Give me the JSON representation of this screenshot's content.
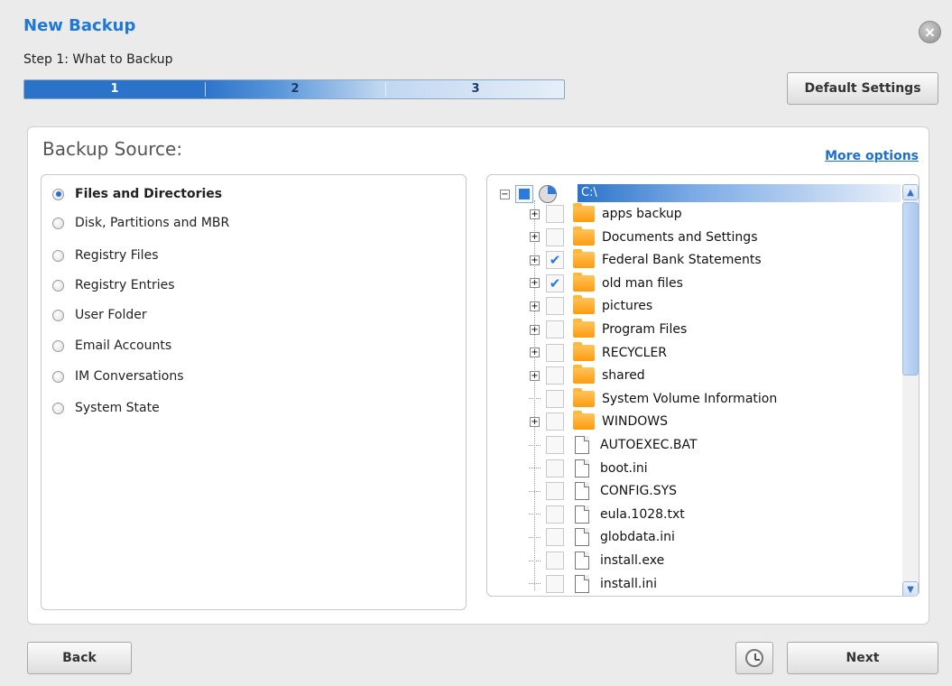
{
  "window": {
    "title": "New Backup",
    "close_glyph": "×"
  },
  "step": {
    "label": "Step 1: What to Backup",
    "numbers": [
      "1",
      "2",
      "3"
    ]
  },
  "buttons": {
    "default_settings": "Default Settings",
    "back": "Back",
    "next": "Next"
  },
  "panel": {
    "title": "Backup Source:",
    "more_options": "More options"
  },
  "source_options": [
    "Files and Directories",
    "Disk, Partitions and MBR",
    "Registry Files",
    "Registry Entries",
    "User Folder",
    "Email Accounts",
    "IM Conversations",
    "System State"
  ],
  "selected_source": "Files and Directories",
  "tree": {
    "root": "C:\\",
    "items": [
      {
        "name": "apps backup",
        "type": "folder",
        "expandable": true,
        "checked": false
      },
      {
        "name": "Documents and Settings",
        "type": "folder",
        "expandable": true,
        "checked": false
      },
      {
        "name": "Federal Bank Statements",
        "type": "folder",
        "expandable": true,
        "checked": true
      },
      {
        "name": "old man files",
        "type": "folder",
        "expandable": true,
        "checked": true
      },
      {
        "name": "pictures",
        "type": "folder",
        "expandable": true,
        "checked": false
      },
      {
        "name": "Program Files",
        "type": "folder",
        "expandable": true,
        "checked": false
      },
      {
        "name": "RECYCLER",
        "type": "folder",
        "expandable": true,
        "checked": false
      },
      {
        "name": "shared",
        "type": "folder",
        "expandable": true,
        "checked": false
      },
      {
        "name": "System Volume Information",
        "type": "folder",
        "expandable": false,
        "checked": false
      },
      {
        "name": "WINDOWS",
        "type": "folder",
        "expandable": true,
        "checked": false
      },
      {
        "name": "AUTOEXEC.BAT",
        "type": "file",
        "expandable": false,
        "checked": false
      },
      {
        "name": "boot.ini",
        "type": "file",
        "expandable": false,
        "checked": false
      },
      {
        "name": "CONFIG.SYS",
        "type": "file",
        "expandable": false,
        "checked": false
      },
      {
        "name": "eula.1028.txt",
        "type": "file",
        "expandable": false,
        "checked": false
      },
      {
        "name": "globdata.ini",
        "type": "file",
        "expandable": false,
        "checked": false
      },
      {
        "name": "install.exe",
        "type": "file",
        "expandable": false,
        "checked": false
      },
      {
        "name": "install.ini",
        "type": "file",
        "expandable": false,
        "checked": false
      }
    ]
  },
  "icons": {
    "close": "close-icon",
    "folder": "folder-icon",
    "file": "file-icon",
    "drive": "drive-icon",
    "schedule": "clock-icon"
  },
  "colors": {
    "accent": "#1f78d6",
    "progress": "#2b73c9",
    "folder": "#ff9b10",
    "check": "#2a78d8"
  }
}
